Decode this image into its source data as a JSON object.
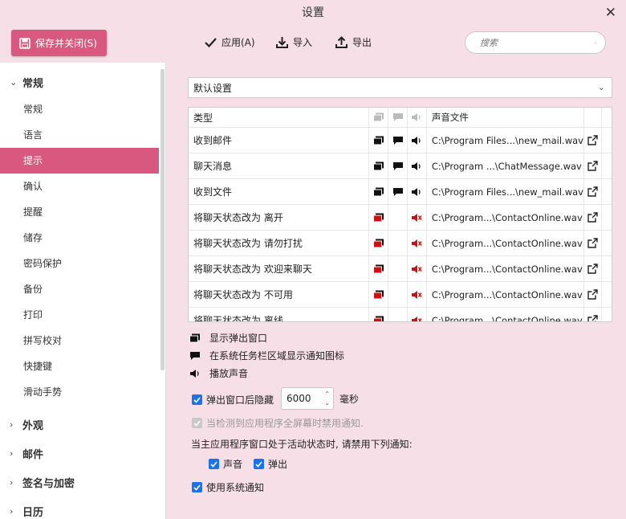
{
  "window": {
    "title": "设置"
  },
  "toolbar": {
    "save_label": "保存并关闭(S)",
    "apply_label": "应用(A)",
    "import_label": "导入",
    "export_label": "导出",
    "search_placeholder": "搜索"
  },
  "sidebar": {
    "groups": [
      {
        "label": "常规",
        "expanded": true
      },
      {
        "label": "外观",
        "expanded": false
      },
      {
        "label": "邮件",
        "expanded": false
      },
      {
        "label": "签名与加密",
        "expanded": false
      },
      {
        "label": "日历",
        "expanded": false
      }
    ],
    "items": [
      "常规",
      "语言",
      "提示",
      "确认",
      "提醒",
      "储存",
      "密码保护",
      "备份",
      "打印",
      "拼写校对",
      "快捷键",
      "滑动手势"
    ],
    "active_item": "提示"
  },
  "profile": {
    "selected": "默认设置"
  },
  "table": {
    "headers": {
      "type": "类型",
      "file": "声音文件"
    },
    "rows": [
      {
        "type": "收到邮件",
        "file": "C:\\Program Files...\\new_mail.wav",
        "popup": true,
        "tray": true,
        "sound": true
      },
      {
        "type": "聊天消息",
        "file": "C:\\Program ...\\ChatMessage.wav",
        "popup": true,
        "tray": true,
        "sound": true
      },
      {
        "type": "收到文件",
        "file": "C:\\Program Files...\\new_mail.wav",
        "popup": true,
        "tray": true,
        "sound": true
      },
      {
        "type": "将聊天状态改为 离开",
        "file": "C:\\Program...\\ContactOnline.wav",
        "popup": false,
        "tray": false,
        "sound": false
      },
      {
        "type": "将聊天状态改为 请勿打扰",
        "file": "C:\\Program...\\ContactOnline.wav",
        "popup": false,
        "tray": false,
        "sound": false
      },
      {
        "type": "将聊天状态改为 欢迎来聊天",
        "file": "C:\\Program...\\ContactOnline.wav",
        "popup": false,
        "tray": false,
        "sound": false
      },
      {
        "type": "将聊天状态改为 不可用",
        "file": "C:\\Program...\\ContactOnline.wav",
        "popup": false,
        "tray": false,
        "sound": false
      },
      {
        "type": "将聊天状态改为 离线",
        "file": "C:\\Program...\\ContactOnline.wav",
        "popup": false,
        "tray": false,
        "sound": false
      }
    ]
  },
  "legend": {
    "popup": "显示弹出窗口",
    "tray": "在系统任务栏区域显示通知图标",
    "sound": "播放声音"
  },
  "options": {
    "hide_popup_label": "弹出窗口后隐藏",
    "hide_popup_checked": true,
    "hide_value": "6000",
    "hide_unit": "毫秒",
    "fullscreen_label": "当检测到应用程序全屏幕时禁用通知.",
    "fullscreen_checked": true,
    "active_window_label": "当主应用程序窗口处于活动状态时, 请禁用下列通知:",
    "sound_label": "声音",
    "sound_checked": true,
    "popup_label": "弹出",
    "popup_checked": true,
    "system_notify_label": "使用系统通知",
    "system_notify_checked": true
  },
  "colors": {
    "accent": "#d9587f",
    "background": "#f7dfe7",
    "checkbox": "#1a73e8",
    "muted_red": "#cc1111"
  }
}
